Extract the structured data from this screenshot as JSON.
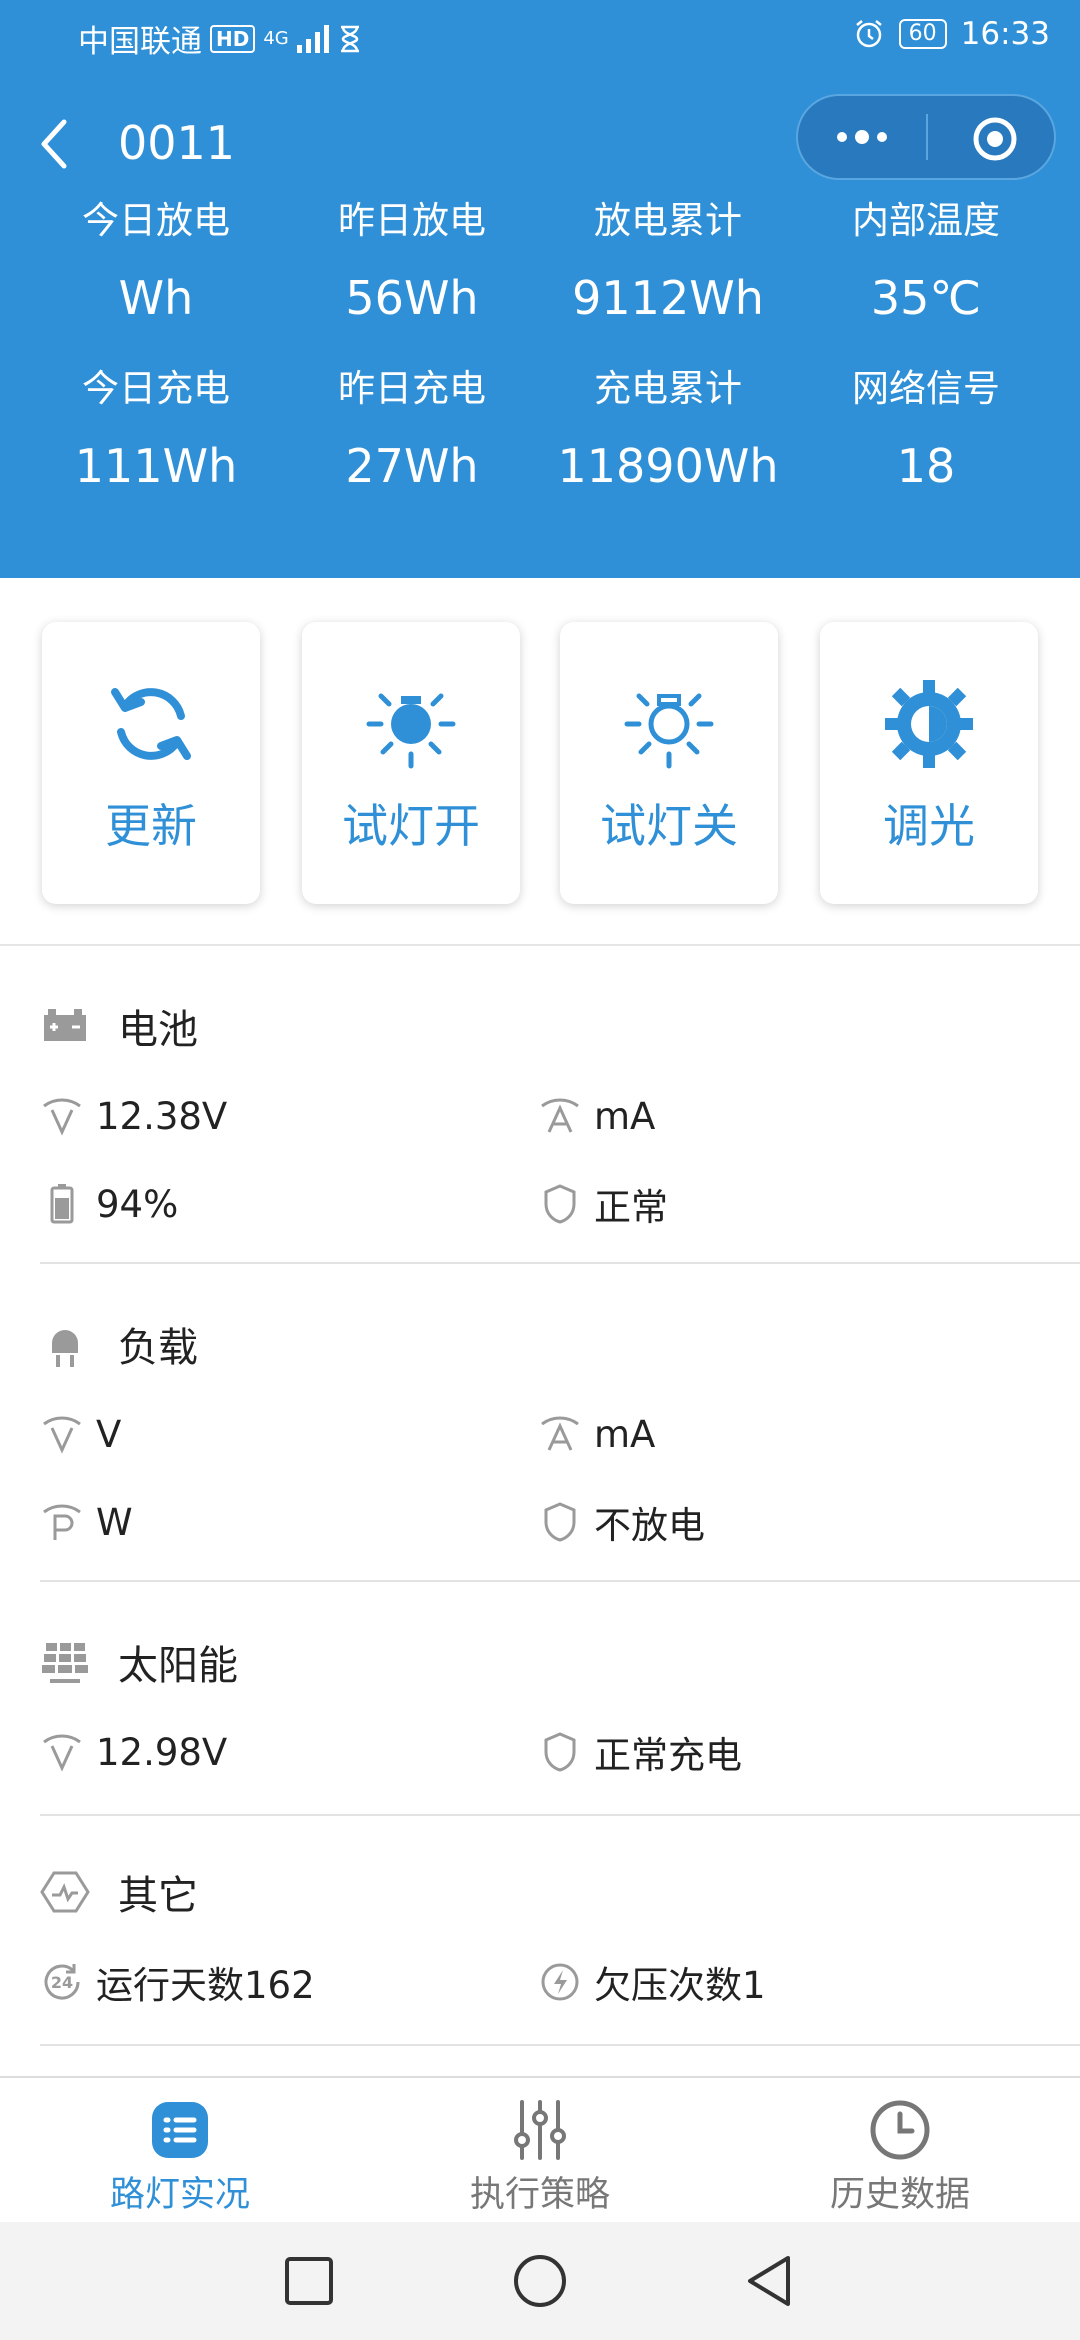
{
  "status_bar": {
    "carrier": "中国联通",
    "hd": "HD",
    "network": "4G",
    "battery": "60",
    "time": "16:33"
  },
  "header": {
    "title": "0011",
    "stats": [
      {
        "label": "今日放电",
        "value": "Wh"
      },
      {
        "label": "昨日放电",
        "value": "56Wh"
      },
      {
        "label": "放电累计",
        "value": "9112Wh"
      },
      {
        "label": "内部温度",
        "value": "35℃"
      },
      {
        "label": "今日充电",
        "value": "111Wh"
      },
      {
        "label": "昨日充电",
        "value": "27Wh"
      },
      {
        "label": "充电累计",
        "value": "11890Wh"
      },
      {
        "label": "网络信号",
        "value": "18"
      }
    ]
  },
  "actions": [
    {
      "label": "更新",
      "icon": "refresh-icon"
    },
    {
      "label": "试灯开",
      "icon": "bulb-on-icon"
    },
    {
      "label": "试灯关",
      "icon": "bulb-off-icon"
    },
    {
      "label": "调光",
      "icon": "dimming-icon"
    }
  ],
  "battery": {
    "title": "电池",
    "voltage": "12.38V",
    "current": "mA",
    "level": "94%",
    "state": "正常"
  },
  "load": {
    "title": "负载",
    "voltage": "V",
    "current": "mA",
    "power": "W",
    "state": "不放电"
  },
  "solar": {
    "title": "太阳能",
    "voltage": "12.98V",
    "state": "正常充电"
  },
  "other": {
    "title": "其它",
    "run_days": "运行天数162",
    "undervoltage": "欠压次数1"
  },
  "tabs": [
    {
      "label": "路灯实况",
      "active": true
    },
    {
      "label": "执行策略",
      "active": false
    },
    {
      "label": "历史数据",
      "active": false
    }
  ],
  "colors": {
    "primary": "#2f90d7",
    "icon_gray": "#9a9a9a"
  }
}
